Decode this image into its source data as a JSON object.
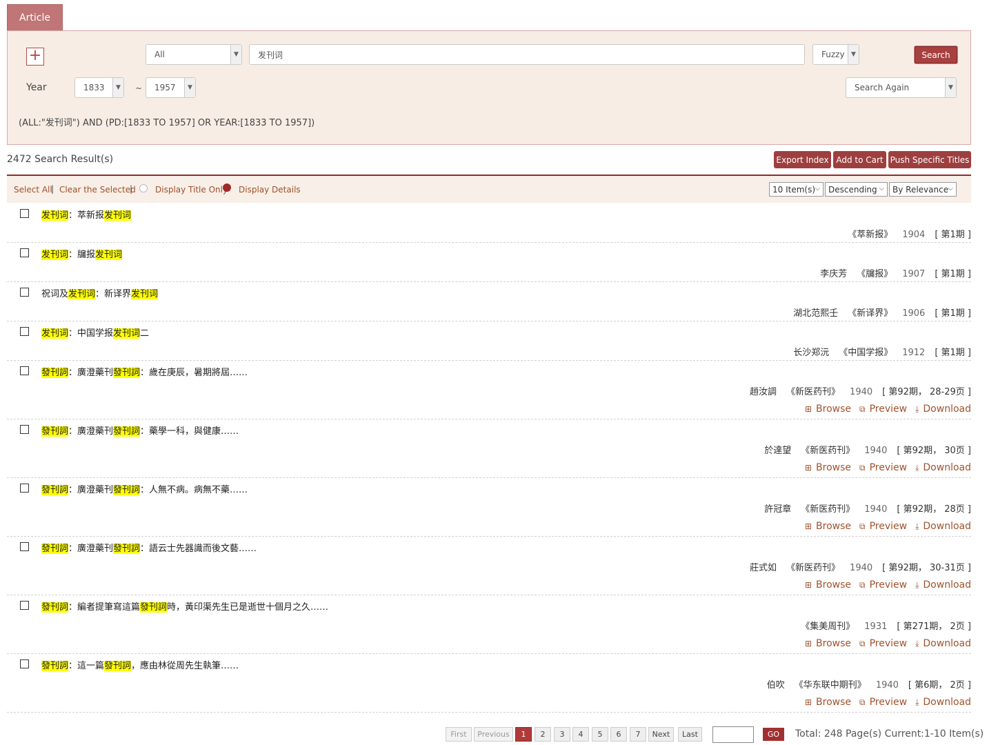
{
  "tab_label": "Article",
  "search": {
    "field_select": "All",
    "query": "发刊词",
    "match_select": "Fuzzy",
    "search_button": "Search",
    "year_label": "Year",
    "year_from": "1833",
    "tilde": "~",
    "year_to": "1957",
    "search_again": "Search Again",
    "query_expression": "(ALL:\"发刊词\") AND (PD:[1833 TO 1957] OR YEAR:[1833 TO 1957])"
  },
  "results_header": {
    "count_text": "2472  Search Result(s)",
    "export_index": "Export Index",
    "add_to_cart": "Add to Cart",
    "push_specific": "Push Specific Titles"
  },
  "toolbar": {
    "select_all": "Select All",
    "sep": "|",
    "clear_selected": "Clear the Selected",
    "display_title_only": "Display Title Only",
    "display_details": "Display Details",
    "per_page": "10 Item(s)",
    "order": "Descending",
    "sort_by": "By Relevance"
  },
  "link_labels": {
    "browse": "Browse",
    "preview": "Preview",
    "download": "Download"
  },
  "results": [
    {
      "title_parts": [
        [
          "发刊词",
          true
        ],
        [
          "：萃新报",
          false
        ],
        [
          "发刊词",
          true
        ]
      ],
      "meta": {
        "author": "",
        "journal": "《萃新报》",
        "year": "1904",
        "issue": "[ 第1期 ]"
      },
      "has_links": false
    },
    {
      "title_parts": [
        [
          "发刊词",
          true
        ],
        [
          "：牖报",
          false
        ],
        [
          "发刊词",
          true
        ]
      ],
      "meta": {
        "author": "李庆芳",
        "journal": "《牖报》",
        "year": "1907",
        "issue": "[ 第1期 ]"
      },
      "has_links": false
    },
    {
      "title_parts": [
        [
          "祝词及",
          false
        ],
        [
          "发刊词",
          true
        ],
        [
          "：新译界",
          false
        ],
        [
          "发刊词",
          true
        ]
      ],
      "meta": {
        "author": "湖北范熙壬",
        "journal": "《新译界》",
        "year": "1906",
        "issue": "[ 第1期 ]"
      },
      "has_links": false
    },
    {
      "title_parts": [
        [
          "发刊词",
          true
        ],
        [
          "：中国学报",
          false
        ],
        [
          "发刊词",
          true
        ],
        [
          "二",
          false
        ]
      ],
      "meta": {
        "author": "长沙郑沅",
        "journal": "《中国学报》",
        "year": "1912",
        "issue": "[ 第1期 ]"
      },
      "has_links": false
    },
    {
      "title_parts": [
        [
          "發刊詞",
          true
        ],
        [
          "：廣澄藥刊",
          false
        ],
        [
          "發刊詞",
          true
        ],
        [
          "：歲在庚辰，暑期將屆……",
          false
        ]
      ],
      "meta": {
        "author": "趙汝調",
        "journal": "《新医药刊》",
        "year": "1940",
        "issue": "[ 第92期， 28-29页 ]"
      },
      "has_links": true
    },
    {
      "title_parts": [
        [
          "發刊詞",
          true
        ],
        [
          "：廣澄藥刊",
          false
        ],
        [
          "發刊詞",
          true
        ],
        [
          "：藥學一科，與健康……",
          false
        ]
      ],
      "meta": {
        "author": "於達望",
        "journal": "《新医药刊》",
        "year": "1940",
        "issue": "[ 第92期， 30页 ]"
      },
      "has_links": true
    },
    {
      "title_parts": [
        [
          "發刊詞",
          true
        ],
        [
          "：廣澄藥刊",
          false
        ],
        [
          "發刊詞",
          true
        ],
        [
          "：人無不病。病無不藥……",
          false
        ]
      ],
      "meta": {
        "author": "許冠章",
        "journal": "《新医药刊》",
        "year": "1940",
        "issue": "[ 第92期， 28页 ]"
      },
      "has_links": true
    },
    {
      "title_parts": [
        [
          "發刊詞",
          true
        ],
        [
          "：廣澄藥刊",
          false
        ],
        [
          "發刊詞",
          true
        ],
        [
          "：語云士先器識而後文藝……",
          false
        ]
      ],
      "meta": {
        "author": "莊式如",
        "journal": "《新医药刊》",
        "year": "1940",
        "issue": "[ 第92期， 30-31页 ]"
      },
      "has_links": true
    },
    {
      "title_parts": [
        [
          "發刊詞",
          true
        ],
        [
          "：編者提筆寫這篇",
          false
        ],
        [
          "發刊詞",
          true
        ],
        [
          "時，黃印渠先生已是逝世十個月之久……",
          false
        ]
      ],
      "meta": {
        "author": "",
        "journal": "《集美周刊》",
        "year": "1931",
        "issue": "[ 第271期， 2页 ]"
      },
      "has_links": true
    },
    {
      "title_parts": [
        [
          "發刊詞",
          true
        ],
        [
          "：這一篇",
          false
        ],
        [
          "發刊詞",
          true
        ],
        [
          "，應由林從周先生執筆……",
          false
        ]
      ],
      "meta": {
        "author": "伯吹",
        "journal": "《华东联中期刊》",
        "year": "1940",
        "issue": "[ 第6期， 2页 ]"
      },
      "has_links": true
    }
  ],
  "pagination": {
    "first": "First",
    "previous": "Previous",
    "pages": [
      "1",
      "2",
      "3",
      "4",
      "5",
      "6",
      "7"
    ],
    "current": "1",
    "next": "Next",
    "last": "Last",
    "go": "GO",
    "total_text": "Total: 248  Page(s) Current:1-10 Item(s)"
  },
  "colors": {
    "accent": "#a84040",
    "panel": "#f8ede4",
    "highlight": "#ffff00",
    "link": "#a0522d"
  }
}
